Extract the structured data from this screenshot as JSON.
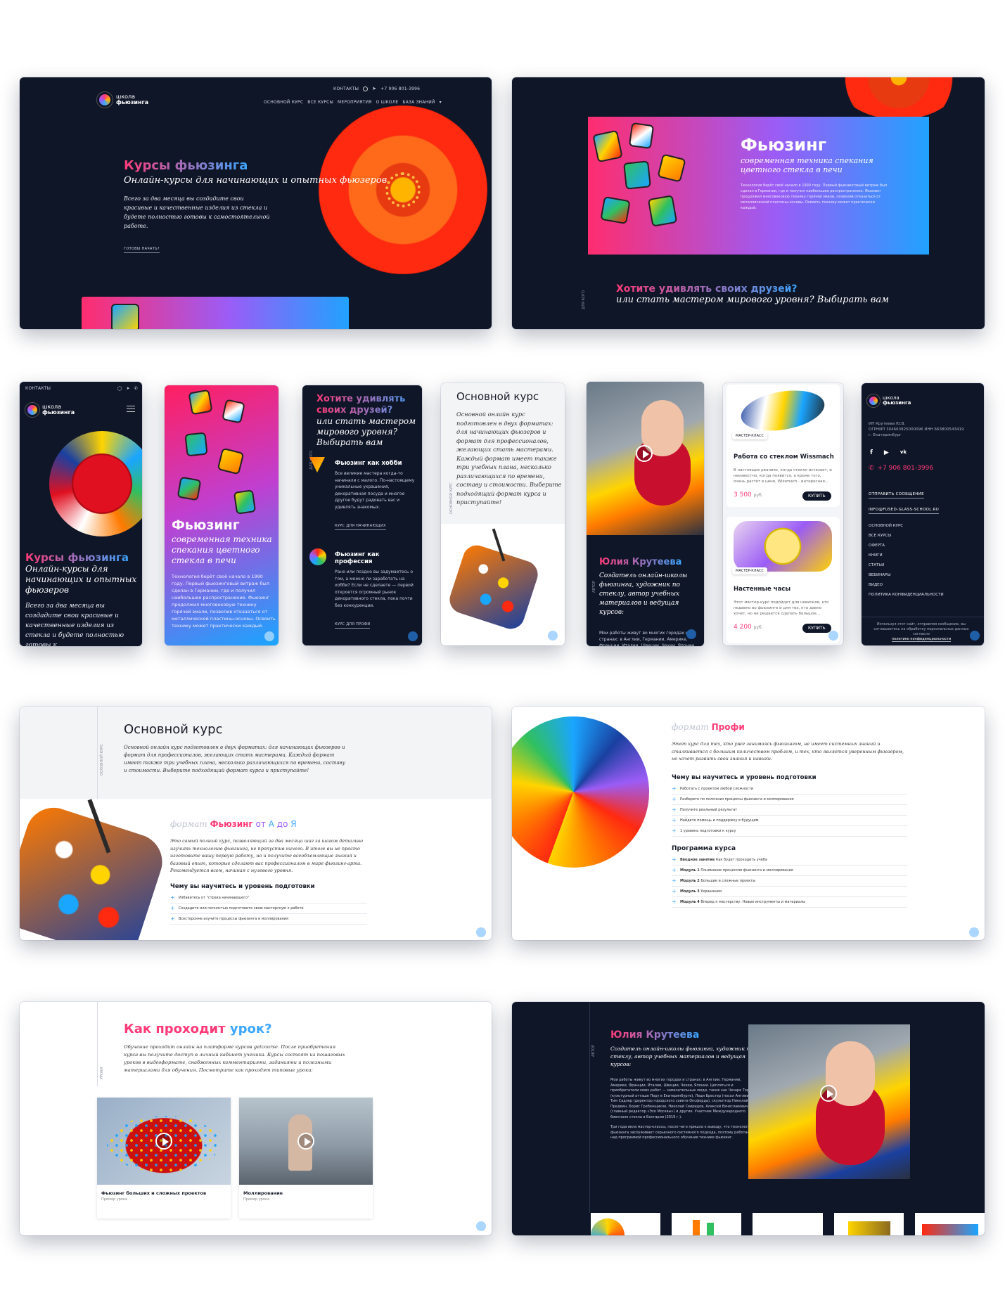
{
  "colors": {
    "dark_bg": "#0f1628",
    "pink": "#ff3a78",
    "blue": "#3ca6ff",
    "accent_fab": "#4aa8ff"
  },
  "site": {
    "logo_line1": "школа",
    "logo_line2": "фьюзинга",
    "contacts_label": "КОНТАКТЫ",
    "phone_short": "+7 906 801-3996",
    "phone": "+7 906 801-3996",
    "nav": [
      "ОСНОВНОЙ КУРС",
      "ВСЕ КУРСЫ",
      "МЕРОПРИЯТИЯ",
      "О ШКОЛЕ",
      "БАЗА ЗНАНИЙ"
    ]
  },
  "hero": {
    "title": "Курсы фьюзинга",
    "subtitle": "Онлайн-курсы для начинающих и опытных фьюзеров",
    "subtitle_mobile": "Онлайн-курсы для начинающих и опытных фьюзеров",
    "text": "Всего за два месяца вы создадите свои красивые и качественные изделия из стекла и будете полностью готовы к самостоятельной работе.",
    "text_mobile": "Всего за два месяца вы создадите свои красивые и качественные изделия из стекла и будете полностью готовы к",
    "cta": "ГОТОВЫ НАЧАТЬ?"
  },
  "fusing": {
    "title": "Фьюзинг",
    "subtitle": "современная техника спекания цветного стекла в печи",
    "text": "Технология берёт своё начало в 1990 году. Первый фьюзинговый витраж был сделан в Германии, где и получил наибольшее распространение. Фьюзинг продолжил многовековую технику горячей эмали, позволив отказаться от металлической пластины-основы. Освоить технику может практически каждый.",
    "q_line1": "Хотите удивлять своих друзей?",
    "q_line2": "или стать мастером мирового уровня? Выбирать вам",
    "m_q1": "Хотите удивлять своих друзей?",
    "m_q2": "или стать мастером мирового уровня? Выбирать вам"
  },
  "hobby": {
    "title1": "Фьюзинг как хобби",
    "text1": "Все великие мастера когда-то начинали с малого. По-настоящему уникальные украшения, декоративная посуда и многое другое будут радовать вас и удивлять знакомых.",
    "link1": "КУРС ДЛЯ НАЧИНАЮЩИХ",
    "title2": "Фьюзинг как профессия",
    "text2": "Рано или поздно вы задумаетесь о том, а можно ли заработать на хобби? Если не сделаете — первой откроется огромный рынок декоративного стекла, пока почти без конкуренции.",
    "link2": "КУРС ДЛЯ ПРОФИ"
  },
  "course": {
    "title": "Основной курс",
    "label": "ОСНОВНОЙ КУРС",
    "text": "Основной онлайн курс подготовлен в двух форматах: для начинающих фьюзеров и формат для профессионалов, желающих стать мастерами. Каждый формат имеет также три учебных плана, несколько различающихся по времени, составу и стоимости. Выберите подходящий формат курса и приступайте!",
    "text_mobile": "Основной онлайн курс подготовлен в двух форматах: для начинающих фьюзеров и формат для профессионалов, желающих стать мастерами. Каждый формат имеет также три учебных плана, несколько различающихся по времени, составу и стоимости. Выберите подходящий формат курса и приступайте!",
    "format_word": "формат",
    "format_a_name": "Фьюзинг",
    "format_a_from": "от",
    "format_a_a": "А",
    "format_a_to": "до",
    "format_a_ya": "Я",
    "format_a_text": "Это самый полный курс, позволяющий за два месяца шаг за шагом детально изучить технологию фьюзинга, не пропустив ничего. В итоге вы не просто изготовите вашу первую работу, но и получите всеобъемлющие знания и базовый опыт, которые сделают вас профессионалом в мире фьюзинг-арта. Рекомендуется всем, начиная с нулевого уровня.",
    "learn_title": "Чему вы научитесь и уровень подготовки",
    "learn_a": [
      "Избавитесь от \"страха начинающего\"",
      "Создадите или полностью подготовите свою мастерскую к работе",
      "Всесторонне изучите процессы фьюзинга и моллирования"
    ],
    "format_pro": "Профи",
    "format_pro_text": "Этот курс для тех, кто уже занимаясь фьюзингом, не имеет системных знаний и сталкивается с большим количеством проблем, и тех, кто является уверенным фьюзером, но хочет развить свои знания и навыки.",
    "learn_pro": [
      "Работать с проектом любой сложности",
      "Разберете по полочкам процессы фьюзинга и моллирования",
      "Получите реальный результат",
      "Найдете помощь и поддержку в будущем",
      "1 уровень подготовки к курсу"
    ],
    "program_title": "Программа курса",
    "program": [
      {
        "mod": "Вводное занятие",
        "text": "Как будет проходить учеба"
      },
      {
        "mod": "Модуль 1",
        "text": "Понимание процессов фьюзинга и моллирования"
      },
      {
        "mod": "Модуль 2",
        "text": "Большие и сложные проекты"
      },
      {
        "mod": "Модуль 3",
        "text": "Украшения"
      },
      {
        "mod": "Модуль 4",
        "text": "Вперед к мастерству. Новые инструменты и материалы"
      }
    ]
  },
  "author": {
    "name": "Юлия Крутеева",
    "role": "Создатель онлайн-школы фьюзинга, художник по стеклу, автор учебных материалов и ведущая курсов:",
    "role_mobile": "Создатель онлайн-школы фьюзинга, художник по стеклу, автор учебных материалов и ведущая курсов:",
    "text": "Мои работы живут во многих городах и странах: в Англии, Германии, Америке, Франции, Италии, Швеции, Чехии, Японии. Цепляться и приобретатели моих работ — замечательные люди, такие как Чезаре Торре (культурный атташе Перу в Екатеринбурге), Леди Брестер (посол Англии), Тим Садлер (директор городского совета Оксфорда), скульптор Николай Предеин, Борис Гребенщиков, Николай Свиридов, Алексей Вячеславович (главный редактор «Эхо Москвы») и другие. Участник Международного биеннале стекла в Болгарии (2019 г.).",
    "text2": "Три года вела мастер-классы, после чего пришла к выводу, что технология фьюзинга заслуживает серьезного системного подхода, поэтому работаю над программой профессионального обучения технике фьюзинг.",
    "text_mobile": "Мои работы живут во многих городах и странах: в Англии, Германии, Америке, Франции, Италии, Швеции, Чехии, Японии",
    "label": "АВТОР"
  },
  "shop": {
    "badge": "МАСТЕР-КЛАСС",
    "items": [
      {
        "title": "Работа со стеклом Wissmach",
        "text": "В настоящих реалиях, когда стекло исчезает, и неизвестно, когда появится, а кроме того, очень растет в цене, Wissmach - интересная...",
        "price": "3 500",
        "currency": "руб.",
        "buy": "КУПИТЬ"
      },
      {
        "title": "Настенные часы",
        "text": "Этот мастер-курс подойдет для новичков, кто недавно во фьюзинге и для тех, кто давно хочет, но не решается сделать большое...",
        "price": "4 200",
        "currency": "руб.",
        "buy": "КУПИТЬ"
      }
    ]
  },
  "footer": {
    "company": "ИП Крутеева Ю.В.",
    "ogrn": "ОГРНИП 304663825000096 ИНН 663800543419",
    "city": "г. Екатеринбург",
    "send": "ОТПРАВИТЬ СООБЩЕНИЕ",
    "email": "INFO@FUSED-GLASS-SCHOOL.RU",
    "links": [
      "ОСНОВНОЙ КУРС",
      "ВСЕ КУРСЫ",
      "ОФЕРТА",
      "КНИГИ",
      "СТАТЬИ",
      "ВЕБИНАРЫ",
      "ВИДЕО",
      "ПОЛИТИКА КОНФИДЕНЦИАЛЬНОСТИ"
    ],
    "consent": "Используя этот сайт, отправляя сообщение, вы соглашаетесь на обработку персональных данных согласно",
    "consent_link": "политике конфиденциальности"
  },
  "lesson": {
    "title_a": "Как проходит",
    "title_b": "урок?",
    "label": "УРОКИ",
    "text": "Обучение проходит онлайн на платформе курсов getcourse. После приобретения курса вы получите доступ в личный кабинет ученика. Курсы состоят из пошаговых уроков в видеоформате, снабженных комментариями, заданиями и полезными материалами для обучения. Посмотрите как проходят типовые уроки:",
    "videos": [
      {
        "title": "Фьюзинг больших и сложных проектов",
        "sub": "Пример урока"
      },
      {
        "title": "Моллирование",
        "sub": "Пример урока"
      }
    ]
  }
}
